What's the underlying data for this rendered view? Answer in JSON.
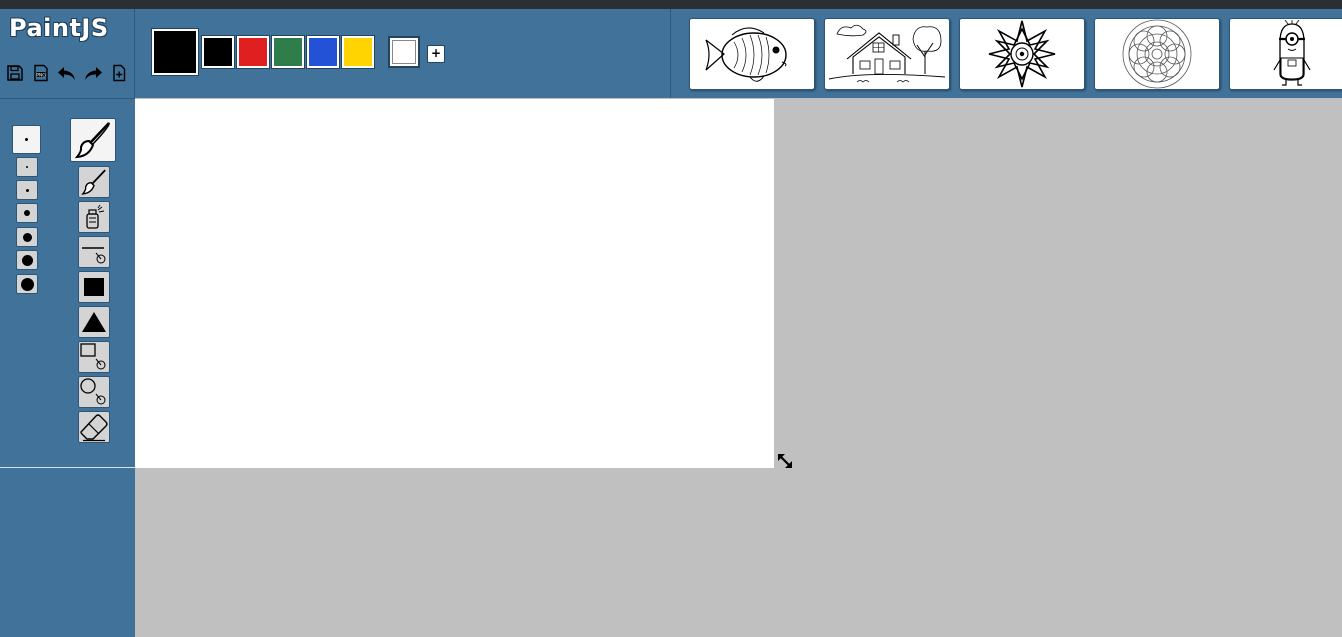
{
  "app": {
    "title": "PaintJS"
  },
  "file_tools": [
    {
      "name": "save-icon"
    },
    {
      "name": "export-image-icon"
    },
    {
      "name": "undo-icon"
    },
    {
      "name": "redo-icon"
    },
    {
      "name": "new-page-icon"
    }
  ],
  "palette": {
    "current_color": "#000000",
    "colors": [
      "#000000",
      "#e02020",
      "#2e7d4a",
      "#2452d6",
      "#ffd400"
    ],
    "background_color": "#ffffff",
    "add_label": "+"
  },
  "templates": [
    {
      "name": "fish-template-thumbnail"
    },
    {
      "name": "house-template-thumbnail"
    },
    {
      "name": "star-mandala-template-thumbnail"
    },
    {
      "name": "round-mandala-template-thumbnail"
    },
    {
      "name": "minion-template-thumbnail"
    }
  ],
  "brush_sizes": [
    {
      "label": "size-1",
      "active": true
    },
    {
      "label": "size-1"
    },
    {
      "label": "size-2"
    },
    {
      "label": "size-3"
    },
    {
      "label": "size-4"
    },
    {
      "label": "size-5"
    },
    {
      "label": "size-6"
    }
  ],
  "tools": [
    {
      "name": "brush-tool-icon",
      "active": true
    },
    {
      "name": "pencil-brush-tool-icon"
    },
    {
      "name": "spray-tool-icon"
    },
    {
      "name": "line-tool-icon"
    },
    {
      "name": "filled-rectangle-tool-icon"
    },
    {
      "name": "filled-triangle-tool-icon"
    },
    {
      "name": "rectangle-outline-tool-icon"
    },
    {
      "name": "circle-outline-tool-icon"
    },
    {
      "name": "eraser-tool-icon"
    }
  ]
}
